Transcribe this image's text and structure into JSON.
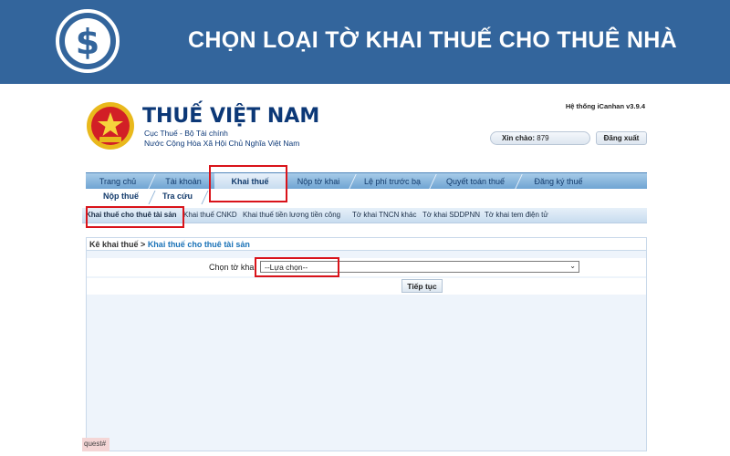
{
  "banner": {
    "title": "CHỌN LOẠI TỜ KHAI THUẾ CHO THUÊ NHÀ",
    "logo_icon": "dollar-coin-icon",
    "background_color": "#33659c"
  },
  "header": {
    "emblem_icon": "national-emblem-icon",
    "emblem_text": "THUẾ NHÀ NƯỚC",
    "title": "THUẾ VIỆT NAM",
    "subtitle1": "Cục Thuế - Bộ Tài chính",
    "subtitle2": "Nước Cộng Hòa Xã Hội Chủ Nghĩa Việt Nam",
    "version": "Hệ thống iCanhan v3.9.4",
    "greeting_label": "Xin chào:",
    "greeting_user": "879",
    "logout_label": "Đăng xuất"
  },
  "menu": {
    "items": [
      {
        "label": "Trang chủ"
      },
      {
        "label": "Tài khoản"
      },
      {
        "label": "Khai thuế",
        "active": true
      },
      {
        "label": "Nộp tờ khai"
      },
      {
        "label": "Lệ phí trước bạ"
      },
      {
        "label": "Quyết toán thuế"
      },
      {
        "label": "Đăng ký thuế"
      }
    ]
  },
  "submenu": {
    "items": [
      {
        "label": "Nộp thuế"
      },
      {
        "label": "Tra cứu"
      }
    ]
  },
  "menu3": {
    "items": [
      {
        "label": "Khai thuế cho thuê tài sản",
        "active": true
      },
      {
        "label": "Khai thuế CNKD"
      },
      {
        "label": "Khai thuế tiền lương tiền công"
      },
      {
        "label": "Tờ khai TNCN khác"
      },
      {
        "label": "Tờ khai SDDPNN"
      },
      {
        "label": "Tờ khai tem điện tử"
      }
    ]
  },
  "content": {
    "breadcrumb_parent": "Kê khai thuế",
    "breadcrumb_sep": ">",
    "breadcrumb_current": "Khai thuế cho thuê tài sản",
    "form_label": "Chọn tờ khai",
    "select_value": "--Lựa chọn--",
    "submit_label": "Tiếp tục"
  },
  "footer": {
    "tag": "quest#"
  },
  "colors": {
    "highlight": "#d9131a",
    "brand_blue": "#0c3877",
    "link_blue": "#1a72b7"
  }
}
